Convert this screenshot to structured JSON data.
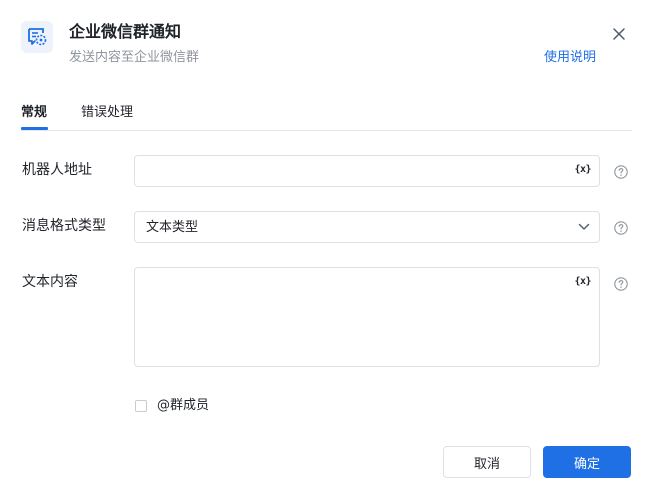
{
  "header": {
    "title": "企业微信群通知",
    "subtitle": "发送内容至企业微信群",
    "help_link": "使用说明"
  },
  "tabs": [
    {
      "label": "常规",
      "active": true
    },
    {
      "label": "错误处理",
      "active": false
    }
  ],
  "form": {
    "robot_address": {
      "label": "机器人地址",
      "value": "",
      "variable_icon": "{x}"
    },
    "message_format": {
      "label": "消息格式类型",
      "selected": "文本类型"
    },
    "text_content": {
      "label": "文本内容",
      "value": "",
      "variable_icon": "{x}"
    },
    "mention_members": {
      "label": "@群成员",
      "checked": false
    }
  },
  "footer": {
    "cancel_label": "取消",
    "confirm_label": "确定"
  },
  "colors": {
    "accent": "#1f6fe5",
    "text": "#1f2329",
    "muted": "#8f959e",
    "border": "#dee0e3"
  }
}
